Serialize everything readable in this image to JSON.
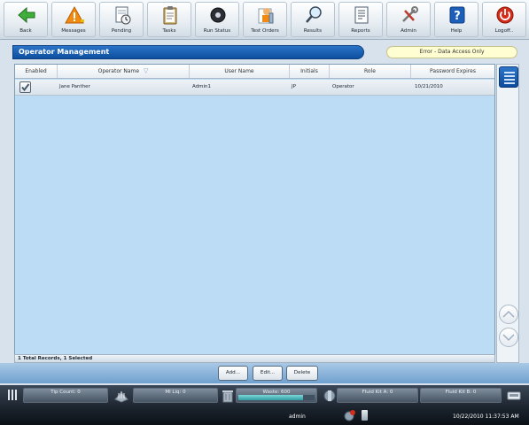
{
  "toolbar": {
    "buttons": [
      {
        "label": "Back",
        "icon": "back-arrow-icon"
      },
      {
        "label": "Messages",
        "icon": "warning-icon"
      },
      {
        "label": "Pending",
        "icon": "pending-document-icon"
      },
      {
        "label": "Tasks",
        "icon": "clipboard-icon"
      },
      {
        "label": "Run Status",
        "icon": "disc-icon"
      },
      {
        "label": "Test Orders",
        "icon": "test-orders-icon"
      },
      {
        "label": "Results",
        "icon": "magnifier-icon"
      },
      {
        "label": "Reports",
        "icon": "report-icon"
      },
      {
        "label": "Admin",
        "icon": "tools-icon"
      },
      {
        "label": "Help",
        "icon": "help-icon"
      },
      {
        "label": "Logoff..",
        "icon": "power-icon"
      }
    ]
  },
  "page": {
    "title": "Operator Management",
    "error_message": "Error - Data Access Only"
  },
  "table": {
    "columns": [
      "Enabled",
      "Operator Name",
      "User Name",
      "Initials",
      "Role",
      "Password Expires"
    ],
    "rows": [
      {
        "enabled": true,
        "operator_name": "Jane Panther",
        "user_name": "Admin1",
        "initials": "JP",
        "role": "Operator",
        "password_expires": "10/21/2010"
      }
    ],
    "footer": "1 Total Records, 1 Selected"
  },
  "actions": {
    "add": "Add...",
    "edit": "Edit...",
    "delete": "Delete"
  },
  "status": {
    "tip_count": "Tip Count: 0",
    "ml_liq": "Ml Liq: 0",
    "waste": "Waste: 600",
    "waste_fill": 0.85,
    "fluid_kit_a": "Fluid Kit A: 0",
    "fluid_kit_b": "Fluid Kit B: 0",
    "user": "admin",
    "datetime": "10/22/2010 11:37:53 AM"
  },
  "colors": {
    "accent": "#0e4f9f",
    "grid_bg": "#bcdcf6",
    "error_bg": "#fffed2"
  }
}
